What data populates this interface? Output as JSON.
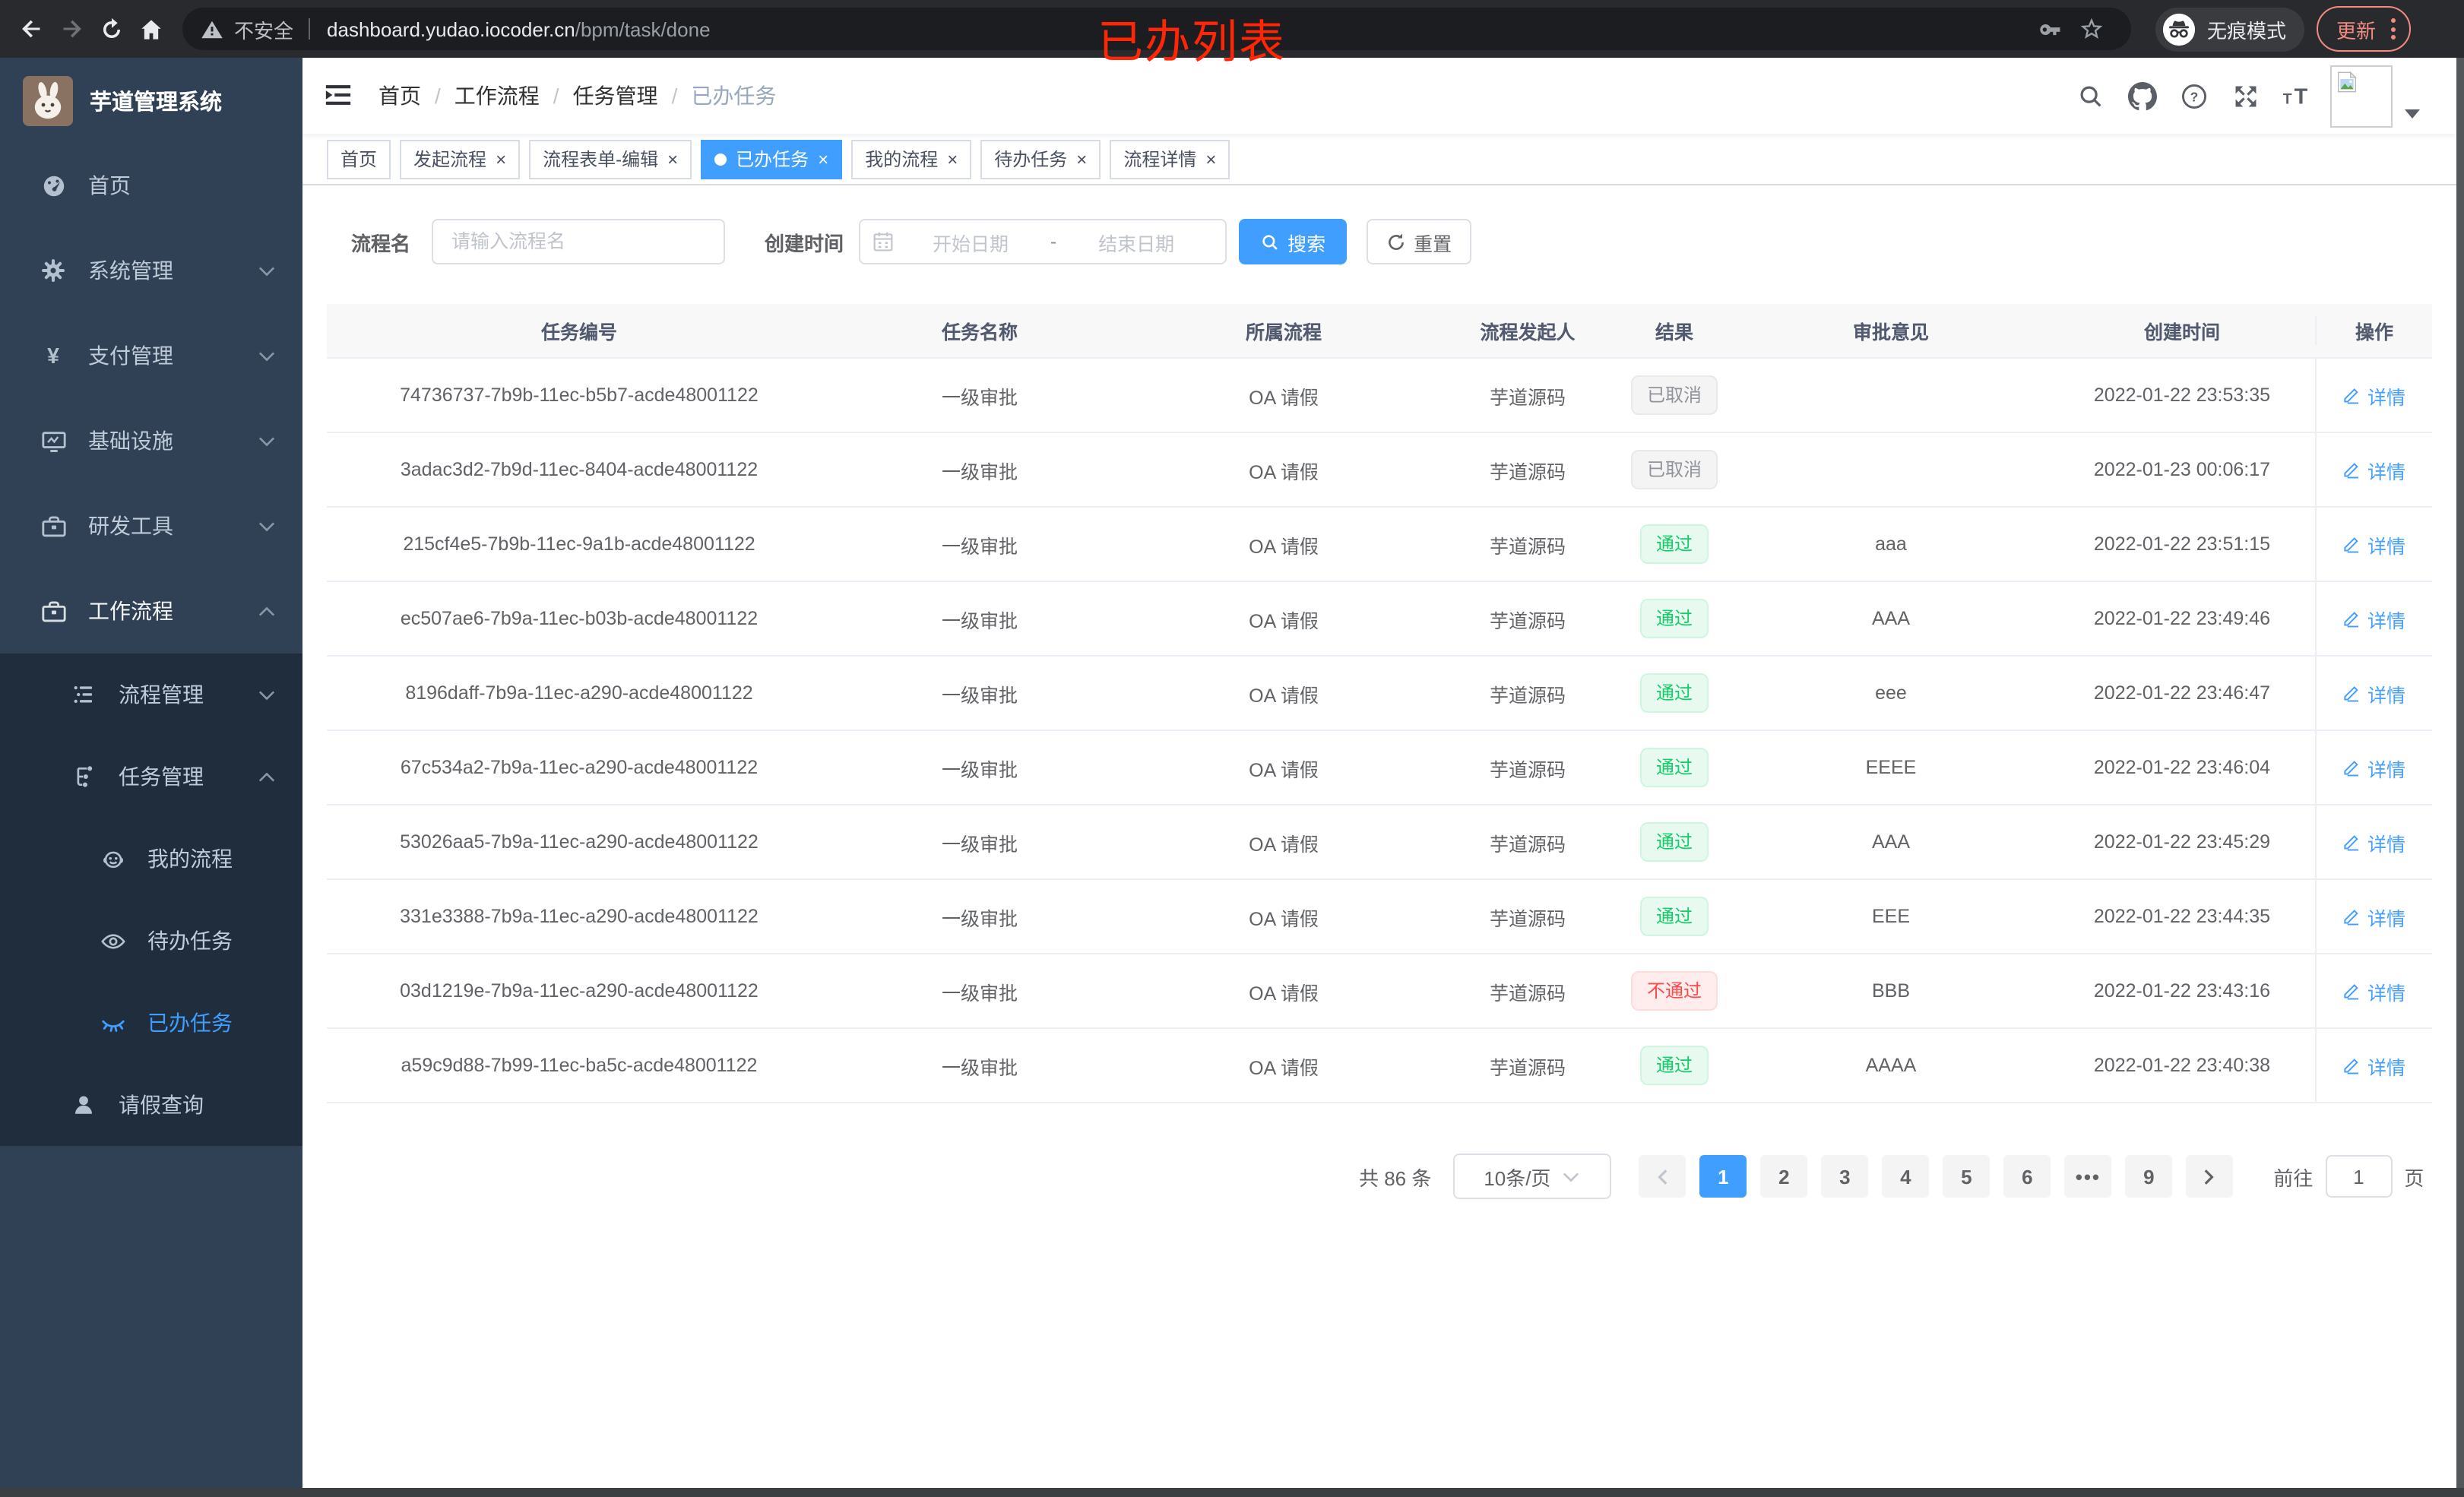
{
  "browser": {
    "security_label": "不安全",
    "url_host": "dashboard.yudao.iocoder.cn",
    "url_path": "/bpm/task/done",
    "incognito_label": "无痕模式",
    "update_label": "更新",
    "annotation": "已办列表"
  },
  "sidebar": {
    "app_title": "芋道管理系统",
    "items": [
      {
        "key": "home",
        "label": "首页",
        "icon": "dashboard-icon",
        "level": 0
      },
      {
        "key": "system",
        "label": "系统管理",
        "icon": "gear-icon",
        "level": 0,
        "chevron": "down"
      },
      {
        "key": "payment",
        "label": "支付管理",
        "icon": "yen-icon",
        "level": 0,
        "chevron": "down"
      },
      {
        "key": "infra",
        "label": "基础设施",
        "icon": "monitor-icon",
        "level": 0,
        "chevron": "down"
      },
      {
        "key": "devtools",
        "label": "研发工具",
        "icon": "toolbox-icon",
        "level": 0,
        "chevron": "down"
      },
      {
        "key": "workflow",
        "label": "工作流程",
        "icon": "briefcase-icon",
        "level": 0,
        "chevron": "up",
        "active_parent": true
      },
      {
        "key": "process-mgmt",
        "label": "流程管理",
        "icon": "flow-list-icon",
        "level": 1,
        "chevron": "down",
        "in_submenu": true
      },
      {
        "key": "task-mgmt",
        "label": "任务管理",
        "icon": "task-tree-icon",
        "level": 1,
        "chevron": "up",
        "in_submenu": true
      },
      {
        "key": "my-process",
        "label": "我的流程",
        "icon": "robot-icon",
        "level": 2,
        "in_submenu": true
      },
      {
        "key": "todo-tasks",
        "label": "待办任务",
        "icon": "eye-open-icon",
        "level": 2,
        "in_submenu": true
      },
      {
        "key": "done-tasks",
        "label": "已办任务",
        "icon": "eye-closed-icon",
        "level": 2,
        "in_submenu": true,
        "active": true
      },
      {
        "key": "leave-query",
        "label": "请假查询",
        "icon": "user-icon",
        "level": 1,
        "in_submenu": true
      }
    ]
  },
  "header": {
    "breadcrumb": [
      "首页",
      "工作流程",
      "任务管理",
      "已办任务"
    ],
    "separator": "/"
  },
  "tabs": {
    "close_glyph": "×",
    "items": [
      {
        "label": "首页",
        "closable": false,
        "active": false
      },
      {
        "label": "发起流程",
        "closable": true,
        "active": false
      },
      {
        "label": "流程表单-编辑",
        "closable": true,
        "active": false
      },
      {
        "label": "已办任务",
        "closable": true,
        "active": true
      },
      {
        "label": "我的流程",
        "closable": true,
        "active": false
      },
      {
        "label": "待办任务",
        "closable": true,
        "active": false
      },
      {
        "label": "流程详情",
        "closable": true,
        "active": false
      }
    ]
  },
  "filters": {
    "name_label": "流程名",
    "name_placeholder": "请输入流程名",
    "date_label": "创建时间",
    "date_start_placeholder": "开始日期",
    "date_separator": "-",
    "date_end_placeholder": "结束日期",
    "search_label": "搜索",
    "reset_label": "重置"
  },
  "table": {
    "columns": [
      "任务编号",
      "任务名称",
      "所属流程",
      "流程发起人",
      "结果",
      "审批意见",
      "创建时间",
      "操作"
    ],
    "action_label": "详情",
    "rows": [
      {
        "id": "74736737-7b9b-11ec-b5b7-acde48001122",
        "name": "一级审批",
        "process": "OA 请假",
        "starter": "芋道源码",
        "result": "已取消",
        "result_type": "info",
        "comment": "",
        "created": "2022-01-22 23:53:35"
      },
      {
        "id": "3adac3d2-7b9d-11ec-8404-acde48001122",
        "name": "一级审批",
        "process": "OA 请假",
        "starter": "芋道源码",
        "result": "已取消",
        "result_type": "info",
        "comment": "",
        "created": "2022-01-23 00:06:17"
      },
      {
        "id": "215cf4e5-7b9b-11ec-9a1b-acde48001122",
        "name": "一级审批",
        "process": "OA 请假",
        "starter": "芋道源码",
        "result": "通过",
        "result_type": "success",
        "comment": "aaa",
        "created": "2022-01-22 23:51:15"
      },
      {
        "id": "ec507ae6-7b9a-11ec-b03b-acde48001122",
        "name": "一级审批",
        "process": "OA 请假",
        "starter": "芋道源码",
        "result": "通过",
        "result_type": "success",
        "comment": "AAA",
        "created": "2022-01-22 23:49:46"
      },
      {
        "id": "8196daff-7b9a-11ec-a290-acde48001122",
        "name": "一级审批",
        "process": "OA 请假",
        "starter": "芋道源码",
        "result": "通过",
        "result_type": "success",
        "comment": "eee",
        "created": "2022-01-22 23:46:47"
      },
      {
        "id": "67c534a2-7b9a-11ec-a290-acde48001122",
        "name": "一级审批",
        "process": "OA 请假",
        "starter": "芋道源码",
        "result": "通过",
        "result_type": "success",
        "comment": "EEEE",
        "created": "2022-01-22 23:46:04"
      },
      {
        "id": "53026aa5-7b9a-11ec-a290-acde48001122",
        "name": "一级审批",
        "process": "OA 请假",
        "starter": "芋道源码",
        "result": "通过",
        "result_type": "success",
        "comment": "AAA",
        "created": "2022-01-22 23:45:29"
      },
      {
        "id": "331e3388-7b9a-11ec-a290-acde48001122",
        "name": "一级审批",
        "process": "OA 请假",
        "starter": "芋道源码",
        "result": "通过",
        "result_type": "success",
        "comment": "EEE",
        "created": "2022-01-22 23:44:35"
      },
      {
        "id": "03d1219e-7b9a-11ec-a290-acde48001122",
        "name": "一级审批",
        "process": "OA 请假",
        "starter": "芋道源码",
        "result": "不通过",
        "result_type": "danger",
        "comment": "BBB",
        "created": "2022-01-22 23:43:16"
      },
      {
        "id": "a59c9d88-7b99-11ec-ba5c-acde48001122",
        "name": "一级审批",
        "process": "OA 请假",
        "starter": "芋道源码",
        "result": "通过",
        "result_type": "success",
        "comment": "AAAA",
        "created": "2022-01-22 23:40:38"
      }
    ]
  },
  "pagination": {
    "total_label": "共 86 条",
    "page_size": "10条/页",
    "pages": [
      {
        "label": "1",
        "active": true
      },
      {
        "label": "2"
      },
      {
        "label": "3"
      },
      {
        "label": "4"
      },
      {
        "label": "5"
      },
      {
        "label": "6"
      },
      {
        "label": "•••",
        "ellipsis": true
      },
      {
        "label": "9"
      }
    ],
    "goto_label": "前往",
    "goto_value": "1",
    "goto_suffix": "页"
  },
  "colors": {
    "accent": "#409eff",
    "success": "#13ce66",
    "danger": "#ff4949",
    "info": "#909399",
    "sidebar_bg": "#304156",
    "submenu_bg": "#1f2d3d",
    "annotation_red": "#ff2505",
    "update_salmon": "#f28b82"
  }
}
